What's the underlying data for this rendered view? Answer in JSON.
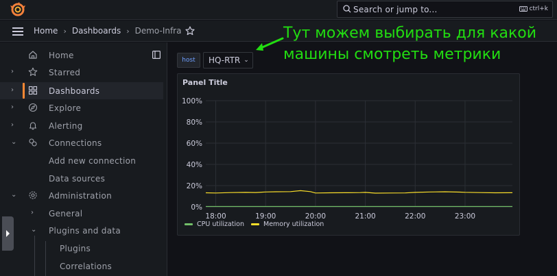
{
  "topbar": {
    "search_placeholder": "Search or jump to...",
    "shortcut": "ctrl+k"
  },
  "breadcrumb": {
    "items": [
      "Home",
      "Dashboards",
      "Demo-Infra"
    ]
  },
  "sidebar": {
    "items": [
      {
        "label": "Home",
        "icon": "home-icon"
      },
      {
        "label": "Starred",
        "icon": "star-icon"
      },
      {
        "label": "Dashboards",
        "icon": "dashboards-icon"
      },
      {
        "label": "Explore",
        "icon": "compass-icon"
      },
      {
        "label": "Alerting",
        "icon": "bell-icon"
      },
      {
        "label": "Connections",
        "icon": "connections-icon"
      },
      {
        "label": "Add new connection"
      },
      {
        "label": "Data sources"
      },
      {
        "label": "Administration",
        "icon": "gear-icon"
      },
      {
        "label": "General"
      },
      {
        "label": "Plugins and data"
      },
      {
        "label": "Plugins"
      },
      {
        "label": "Correlations"
      }
    ]
  },
  "variable": {
    "label": "host",
    "value": "HQ-RTR"
  },
  "annotation": {
    "line1": "Тут можем выбирать для какой",
    "line2": "машины смотреть метрики",
    "color": "#22dd11"
  },
  "panel": {
    "title": "Panel Title"
  },
  "chart_data": {
    "type": "line",
    "title": "Panel Title",
    "y_ticks": [
      "0%",
      "20%",
      "40%",
      "60%",
      "80%",
      "100%"
    ],
    "x_ticks": [
      "18:00",
      "19:00",
      "20:00",
      "21:00",
      "22:00",
      "23:00"
    ],
    "ylim": [
      0,
      100
    ],
    "x_range_hours": [
      17.8,
      23.95
    ],
    "grid": true,
    "legend_placement": "bottom",
    "series": [
      {
        "name": "CPU utilization",
        "color": "#73bf69",
        "x": [
          17.8,
          19.0,
          20.0,
          21.0,
          22.0,
          23.0,
          23.95
        ],
        "values": [
          0.3,
          0.3,
          0.3,
          0.3,
          0.3,
          0.3,
          0.3
        ]
      },
      {
        "name": "Memory utilization",
        "color": "#fade2a",
        "x": [
          17.8,
          18.0,
          18.3,
          18.6,
          18.8,
          19.0,
          19.2,
          19.5,
          19.7,
          19.9,
          20.0,
          20.3,
          20.6,
          20.9,
          21.0,
          21.2,
          21.5,
          21.8,
          22.0,
          22.3,
          22.6,
          22.9,
          23.0,
          23.3,
          23.6,
          23.95
        ],
        "values": [
          13.2,
          13.0,
          13.4,
          13.6,
          13.5,
          14.0,
          14.2,
          14.3,
          15.2,
          14.3,
          13.0,
          13.2,
          13.3,
          13.4,
          13.6,
          12.9,
          13.0,
          13.1,
          13.6,
          14.0,
          14.2,
          13.9,
          13.7,
          13.4,
          13.2,
          13.3
        ]
      }
    ]
  }
}
